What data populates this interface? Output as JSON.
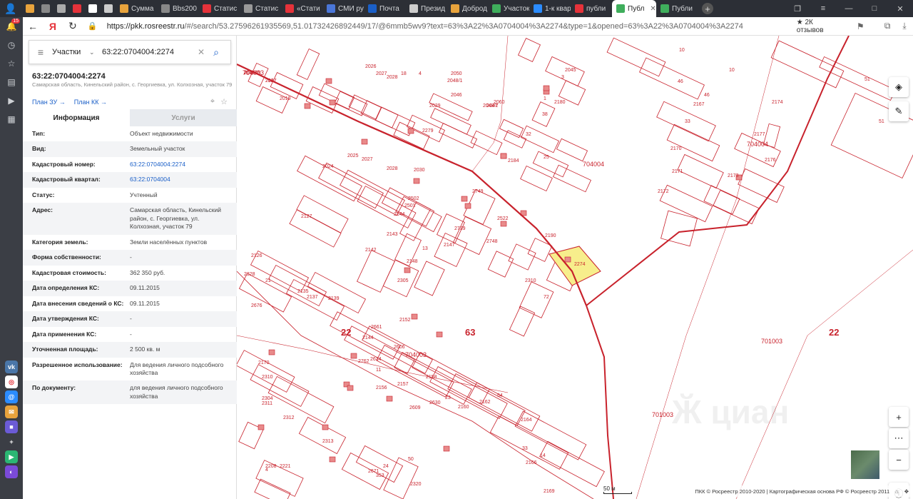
{
  "browser": {
    "tabs": [
      {
        "label": "",
        "color": "#e8a33c"
      },
      {
        "label": "",
        "color": "#888888"
      },
      {
        "label": "",
        "color": "#aaaaaa"
      },
      {
        "label": "",
        "color": "#e5323a"
      },
      {
        "label": "",
        "color": "#ffffff"
      },
      {
        "label": "",
        "color": "#cccccc"
      },
      {
        "label": "Сумма",
        "color": "#e8a33c"
      },
      {
        "label": "Bbs200",
        "color": "#888888"
      },
      {
        "label": "Статис",
        "color": "#e5323a"
      },
      {
        "label": "Статис",
        "color": "#999999"
      },
      {
        "label": "«Стати",
        "color": "#e5323a"
      },
      {
        "label": "СМИ ру",
        "color": "#4a76d8"
      },
      {
        "label": "Почта",
        "color": "#1a5fc8"
      },
      {
        "label": "Презид",
        "color": "#cccccc"
      },
      {
        "label": "Доброд",
        "color": "#e8a33c"
      },
      {
        "label": "Участок",
        "color": "#3fae5c"
      },
      {
        "label": "1-к квар",
        "color": "#2b8cff"
      },
      {
        "label": "публи",
        "color": "#e5323a"
      },
      {
        "label": "Публ",
        "color": "#3fae5c",
        "active": true
      },
      {
        "label": "Публи",
        "color": "#3fae5c"
      }
    ],
    "close_glyph": "✕",
    "new_tab": "+",
    "url_host": "https://pkk.rosreestr.ru",
    "url_rest": "/#/search/53.27596261935569,51.01732426892449/17/@6mmb5wv9?text=63%3A22%3A0704004%3A2274&type=1&opened=63%3A22%3A0704004%3A2274",
    "reviews": "★ 2К отзывов",
    "notification_count": "15"
  },
  "panel": {
    "search_type": "Участки",
    "search_value": "63:22:0704004:2274",
    "object_title": "63:22:0704004:2274",
    "object_address": "Самарская область, Кинельский район, с. Георгиевка, ул. Колхозная, участок 79",
    "link_plan_zu": "План ЗУ →",
    "link_plan_kk": "План КК →",
    "tab_info": "Информация",
    "tab_services": "Услуги",
    "props": [
      {
        "k": "Тип:",
        "v": "Объект недвижимости"
      },
      {
        "k": "Вид:",
        "v": "Земельный участок"
      },
      {
        "k": "Кадастровый номер:",
        "v": "63:22:0704004:2274",
        "link": true
      },
      {
        "k": "Кадастровый квартал:",
        "v": "63:22:0704004",
        "link": true
      },
      {
        "k": "Статус:",
        "v": "Учтенный"
      },
      {
        "k": "Адрес:",
        "v": "Самарская область, Кинельский район, с. Георгиевка, ул. Колхозная, участок 79"
      },
      {
        "k": "Категория земель:",
        "v": "Земли населённых пунктов"
      },
      {
        "k": "Форма собственности:",
        "v": "-"
      },
      {
        "k": "Кадастровая стоимость:",
        "v": "362 350 руб."
      },
      {
        "k": "Дата определения КС:",
        "v": "09.11.2015"
      },
      {
        "k": "Дата внесения сведений о КС:",
        "v": "09.11.2015"
      },
      {
        "k": "Дата утверждения КС:",
        "v": "-"
      },
      {
        "k": "Дата применения КС:",
        "v": "-"
      },
      {
        "k": "Уточненная площадь:",
        "v": "2 500 кв. м"
      },
      {
        "k": "Разрешенное использование:",
        "v": "Для ведения личного подсобного хозяйства"
      },
      {
        "k": "По документу:",
        "v": "для ведения личного подсобного хозяйства"
      }
    ]
  },
  "map": {
    "parcel_labels": [
      "704003",
      "2017",
      "2019",
      "2026",
      "2027",
      "2028",
      "18",
      "4",
      "2029",
      "2279",
      "2050",
      "2048/1",
      "2048/2",
      "2046",
      "2060",
      "2047",
      "2045",
      "3",
      "1",
      "38",
      "2180",
      "32",
      "25",
      "2184",
      "10",
      "10",
      "46",
      "46",
      "2167",
      "33",
      "2170",
      "2171",
      "2172",
      "2177",
      "2176",
      "2173",
      "2174",
      "51",
      "51",
      "2280",
      "2025",
      "2024",
      "2027",
      "2028",
      "2030",
      "2502",
      "2501",
      "2144",
      "2749",
      "2739",
      "2147",
      "2143",
      "2142",
      "2748",
      "2522",
      "13",
      "2148",
      "2305",
      "2190",
      "2274",
      "2310",
      "72",
      "2126",
      "2127",
      "21",
      "2135",
      "2137",
      "2139",
      "2144",
      "2661",
      "2606",
      "2152",
      "2634",
      "11",
      "2762",
      "2156",
      "2157",
      "2158",
      "2609",
      "2630",
      "23",
      "2160",
      "2162",
      "54",
      "2164",
      "33",
      "2166",
      "14",
      "2169",
      "8",
      "2170",
      "2310",
      "2311",
      "2312",
      "2313",
      "24",
      "2671",
      "353",
      "2320",
      "50",
      "2221",
      "2208",
      "4",
      "2304",
      "2328",
      "2676",
      "2689/2",
      "2127"
    ],
    "quarter_labels": [
      "704003",
      "704004",
      "704004",
      "704003",
      "701003",
      "701003"
    ],
    "district_labels": [
      "22",
      "63",
      "22"
    ],
    "scale": "50 м",
    "footer": "ПКК © Росреестр 2010-2020 | Картографическая основа РФ © Росреестр 2011",
    "highlight_color": "#f7ee8c",
    "boundary_color": "#c8222c"
  }
}
